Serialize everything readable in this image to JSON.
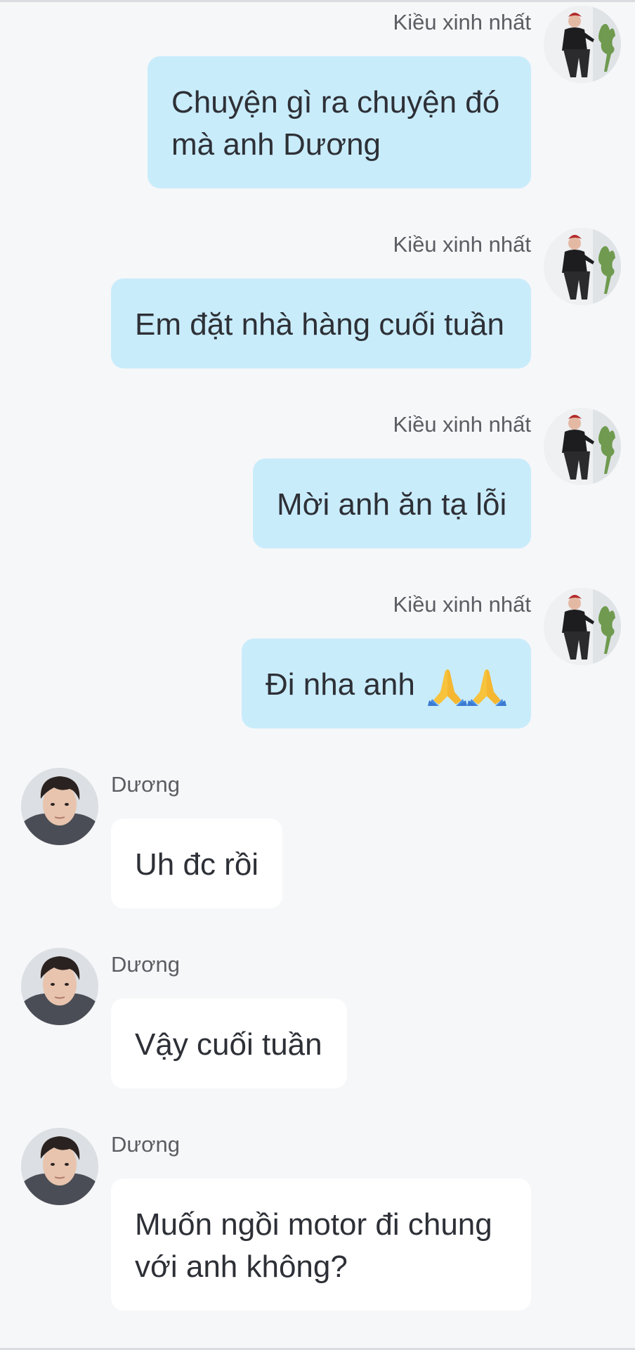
{
  "conversation": {
    "messages": [
      {
        "sender": "Kiều xinh nhất",
        "side": "mine",
        "lines": [
          "Chuyện gì ra chuyện đó",
          "mà anh Dương"
        ]
      },
      {
        "sender": "Kiều xinh nhất",
        "side": "mine",
        "lines": [
          "Em đặt nhà hàng cuối tuần"
        ]
      },
      {
        "sender": "Kiều xinh nhất",
        "side": "mine",
        "lines": [
          "Mời anh ăn tạ lỗi"
        ]
      },
      {
        "sender": "Kiều xinh nhất",
        "side": "mine",
        "lines": [
          "Đi nha anh"
        ],
        "emoji": "praying-hands x2"
      },
      {
        "sender": "Dương",
        "side": "theirs",
        "lines": [
          "Uh đc rồi"
        ]
      },
      {
        "sender": "Dương",
        "side": "theirs",
        "lines": [
          "Vậy cuối tuần"
        ]
      },
      {
        "sender": "Dương",
        "side": "theirs",
        "lines": [
          "Muốn ngồi motor đi chung",
          "với anh không?"
        ]
      }
    ]
  },
  "colors": {
    "background": "#f6f7f9",
    "my_bubble": "#c9ecfb",
    "their_bubble": "#ffffff",
    "text": "#2d3036",
    "name_text": "#5a5d62"
  },
  "icons": {
    "my_avatar": "avatar-kieu-icon",
    "their_avatar": "avatar-duong-icon",
    "emoji": "praying-hands-icon"
  }
}
